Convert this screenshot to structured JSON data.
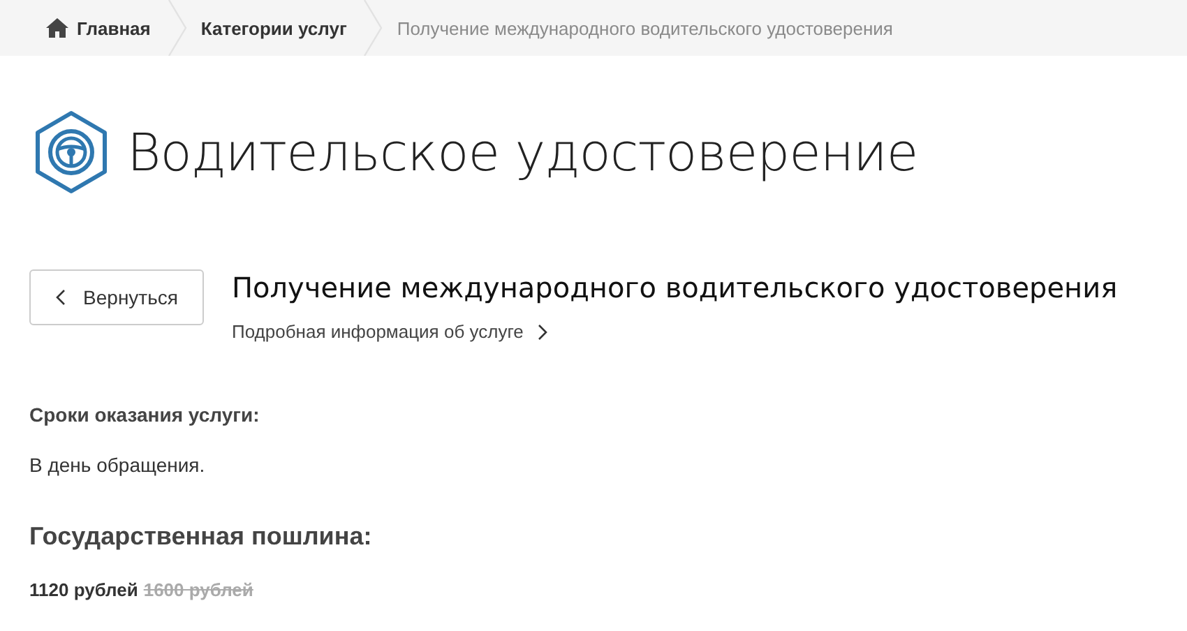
{
  "breadcrumbs": [
    {
      "label": "Главная",
      "kind": "home"
    },
    {
      "label": "Категории услуг",
      "kind": "link"
    },
    {
      "label": "Получение международного водительского удостоверения",
      "kind": "current"
    }
  ],
  "page_title": "Водительское удостоверение",
  "back_button": "Вернуться",
  "service": {
    "title": "Получение международного водительского удостоверения",
    "details_link": "Подробная информация об услуге"
  },
  "sections": [
    {
      "kind": "terms",
      "heading": "Сроки оказания услуги:",
      "text": "В день обращения."
    },
    {
      "kind": "fee",
      "heading": "Государственная пошлина:",
      "price": "1120 рублей",
      "old_price": "1600 рублей"
    }
  ]
}
